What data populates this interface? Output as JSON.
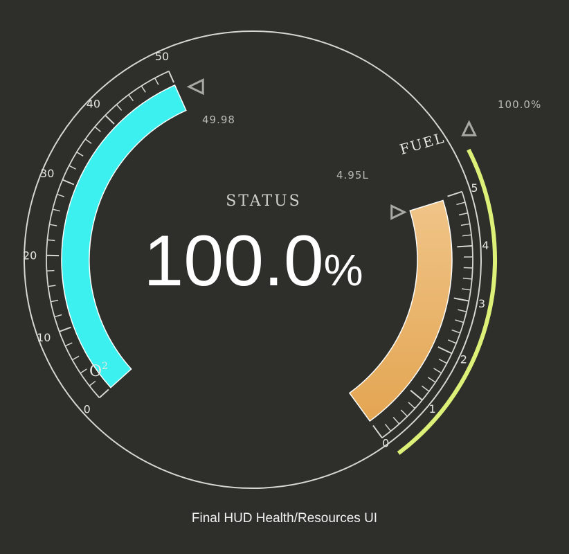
{
  "colors": {
    "background": "#2e2e2a",
    "oxygen": "#3df0f0",
    "fuel_top": "#f0c488",
    "fuel_bottom": "#e3a552",
    "integrity": "#ddf077",
    "ring": "#d6d6d2"
  },
  "status": {
    "label": "STATUS",
    "value": "100.0",
    "unit": "%",
    "percent": 100.0
  },
  "oxygen": {
    "name": "O",
    "superscript": "2",
    "min": 0,
    "max": 50,
    "value": 49.98,
    "readout": "49.98",
    "ticks": [
      "0",
      "10",
      "20",
      "30",
      "40",
      "50"
    ],
    "pointer_icon": "triangle-pointer-icon"
  },
  "fuel": {
    "name": "FUEL",
    "min": 0,
    "max": 5,
    "value": 4.95,
    "readout": "4.95L",
    "ticks": [
      "0",
      "1",
      "2",
      "3",
      "4",
      "5"
    ],
    "pointer_icon": "triangle-pointer-icon"
  },
  "integrity": {
    "value": 100.0,
    "readout": "100.0%",
    "pointer_icon": "triangle-pointer-icon"
  },
  "caption": "Final HUD Health/Resources UI"
}
